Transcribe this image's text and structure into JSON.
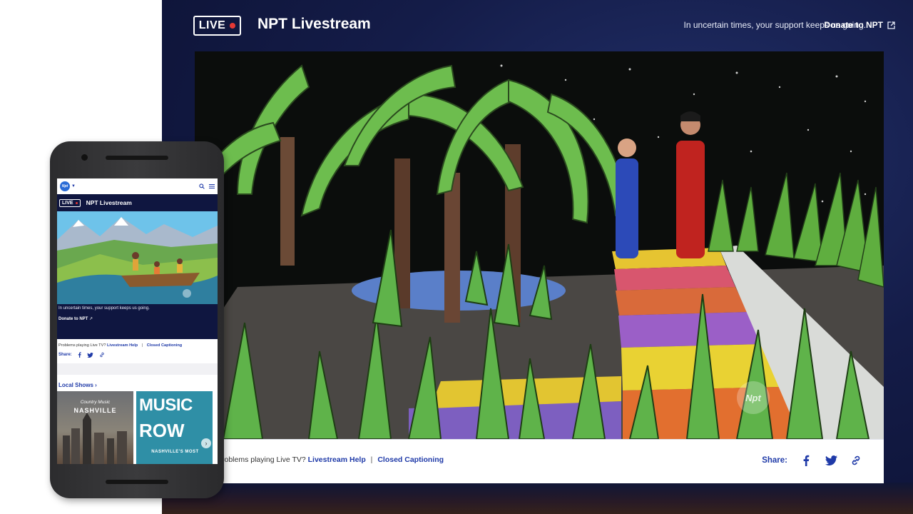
{
  "desktop": {
    "live_label": "LIVE",
    "title": "NPT Livestream",
    "support_text": "In uncertain times, your support keeps us going.",
    "donate_label": "Donate to NPT",
    "watermark": "Npt",
    "help_prefix": "roblems playing Live TV?",
    "help_link": "Livestream Help",
    "separator": "|",
    "captioning_link": "Closed Captioning",
    "share_label": "Share:",
    "share_icons": [
      "facebook-icon",
      "twitter-icon",
      "link-icon"
    ]
  },
  "mobile": {
    "logo": "Npt",
    "live_label": "LIVE",
    "title": "NPT Livestream",
    "support_text": "In uncertain times, your support keeps us going.",
    "donate_label": "Donate to NPT",
    "help_prefix": "Problems playing Live TV?",
    "help_link": "Livestream Help",
    "separator": "|",
    "captioning_link": "Closed Captioning",
    "share_label": "Share:",
    "local_shows_label": "Local Shows",
    "shows": [
      {
        "name": "Country Music NASHVILLE",
        "subtitle": "Country Music",
        "title": "NASHVILLE"
      },
      {
        "name": "MUSIC ROW",
        "title_top": "MUSIC",
        "title_bottom": "ROW",
        "subtitle": "NASHVILLE'S MOST"
      }
    ]
  },
  "colors": {
    "brand_navy": "#0f1640",
    "link_blue": "#1f3aa8",
    "live_red": "#e53935"
  }
}
